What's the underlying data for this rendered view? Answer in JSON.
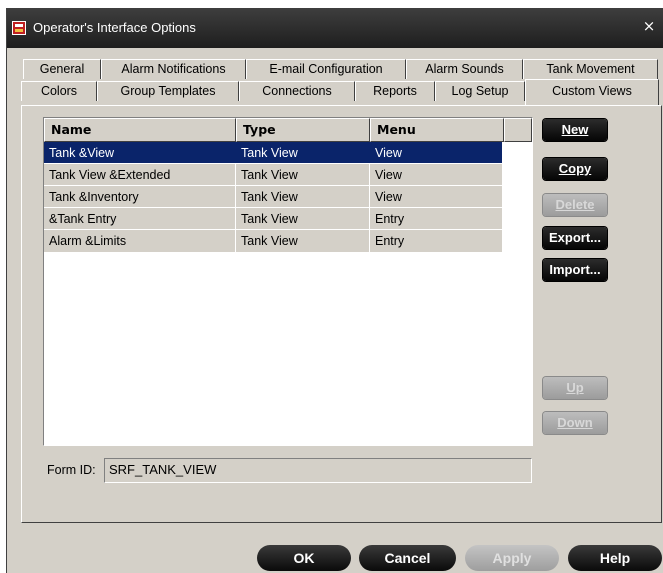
{
  "window": {
    "title": "Operator's Interface Options",
    "close_glyph": "×"
  },
  "tabs_row1": [
    {
      "label": "General"
    },
    {
      "label": "Alarm Notifications"
    },
    {
      "label": "E-mail Configuration"
    },
    {
      "label": "Alarm Sounds"
    },
    {
      "label": "Tank Movement"
    }
  ],
  "tabs_row2": [
    {
      "label": "Colors"
    },
    {
      "label": "Group Templates"
    },
    {
      "label": "Connections"
    },
    {
      "label": "Reports"
    },
    {
      "label": "Log Setup"
    },
    {
      "label": "Custom Views",
      "active": true
    }
  ],
  "list": {
    "columns": [
      "Name",
      "Type",
      "Menu"
    ],
    "rows": [
      {
        "name": "Tank &View",
        "type": "Tank View",
        "menu": "View",
        "selected": true
      },
      {
        "name": "Tank View &Extended",
        "type": "Tank View",
        "menu": "View"
      },
      {
        "name": "Tank &Inventory",
        "type": "Tank View",
        "menu": "View"
      },
      {
        "name": "&Tank Entry",
        "type": "Tank View",
        "menu": "Entry"
      },
      {
        "name": "Alarm &Limits",
        "type": "Tank View",
        "menu": "Entry"
      }
    ]
  },
  "side_buttons": {
    "new_label": "New",
    "copy_label": "Copy",
    "delete_label": "Delete",
    "export_label": "Export...",
    "import_label": "Import...",
    "up_label": "Up",
    "down_label": "Down"
  },
  "form_id": {
    "label": "Form ID:",
    "value": "SRF_TANK_VIEW"
  },
  "footer": {
    "ok_label": "OK",
    "cancel_label": "Cancel",
    "apply_label": "Apply",
    "help_label": "Help"
  },
  "colors": {
    "selection": "#0a246a",
    "dialog_bg": "#d4d0c8",
    "button_bg": "#0a0a0a"
  }
}
